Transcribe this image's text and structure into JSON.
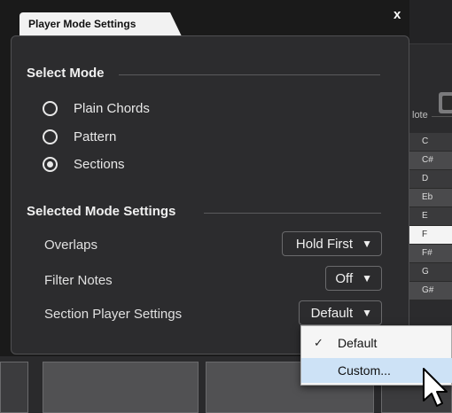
{
  "dialog": {
    "tab_title": "Player Mode Settings",
    "close_label": "x"
  },
  "select_mode": {
    "title": "Select Mode",
    "options": [
      {
        "label": "Plain Chords",
        "checked": false
      },
      {
        "label": "Pattern",
        "checked": false
      },
      {
        "label": "Sections",
        "checked": true
      }
    ]
  },
  "selected_mode_settings": {
    "title": "Selected Mode Settings",
    "rows": [
      {
        "label": "Overlaps",
        "value": "Hold First"
      },
      {
        "label": "Filter Notes",
        "value": "Off"
      },
      {
        "label": "Section Player Settings",
        "value": "Default"
      }
    ]
  },
  "popup_menu": {
    "items": [
      {
        "label": "Default",
        "checked": true,
        "highlighted": false
      },
      {
        "label": "Custom...",
        "checked": false,
        "highlighted": true
      }
    ]
  },
  "background": {
    "note_header": "lote",
    "keys": [
      "C",
      "C#",
      "D",
      "Eb",
      "E",
      "F",
      "F#",
      "G",
      "G#"
    ]
  },
  "icons": {
    "dropdown_arrow": "triangle-down-icon",
    "check": "checkmark-icon",
    "cursor": "mouse-pointer-icon"
  }
}
